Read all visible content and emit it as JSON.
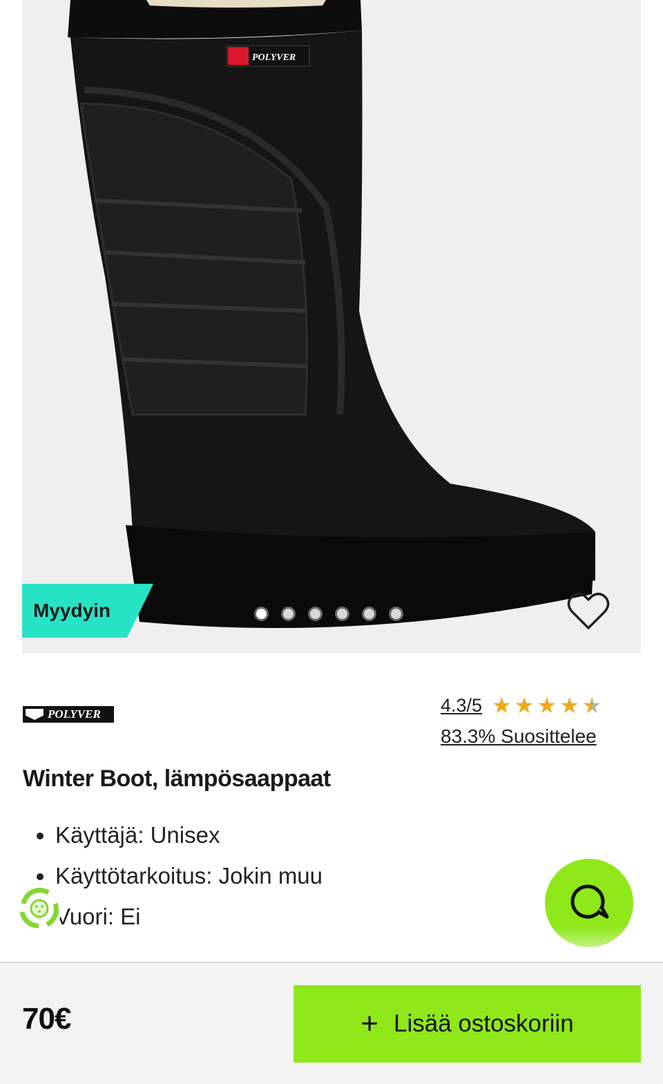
{
  "product": {
    "brand": "POLYVER",
    "badge": "Myydyin",
    "title": "Winter Boot, lämpösaappaat",
    "rating_text": "4.3/5",
    "rating_value": 4.3,
    "rating_max": 5,
    "recommend_text": "83.3% Suosittelee",
    "specs": [
      "Käyttäjä: Unisex",
      "Käyttötarkoitus: Jokin muu",
      "Vuori: Ei"
    ],
    "image_count": 6,
    "active_image": 1
  },
  "footer": {
    "price": "70€",
    "add_to_cart_label": "Lisää ostoskoriin",
    "add_icon": "plus-icon"
  },
  "colors": {
    "accent_green": "#8ee81a",
    "badge_teal": "#27e3c5",
    "star": "#f0a91a"
  }
}
